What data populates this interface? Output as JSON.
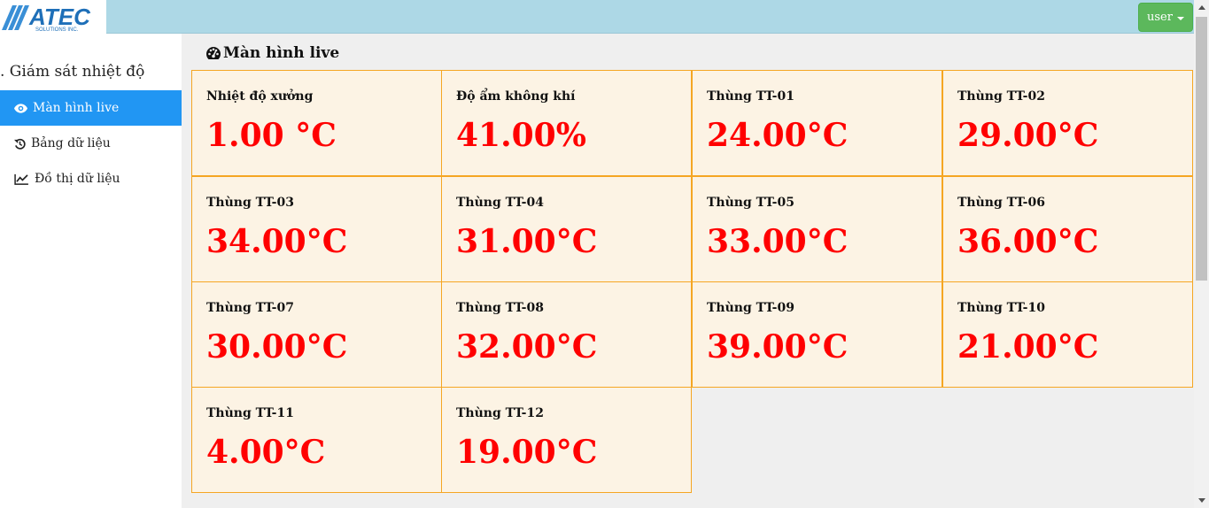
{
  "header": {
    "logo_text": "ATEC",
    "logo_subtext": "SOLUTIONS INC.",
    "user_label": "user"
  },
  "sidebar": {
    "title": ". Giám sát nhiệt độ",
    "items": [
      {
        "label": "Màn hình live",
        "icon": "eye-icon",
        "active": true
      },
      {
        "label": "Bảng dữ liệu",
        "icon": "history-icon",
        "active": false
      },
      {
        "label": "Đồ thị dữ liệu",
        "icon": "line-chart-icon",
        "active": false
      }
    ]
  },
  "main": {
    "title": "Màn hình live",
    "title_icon": "dashboard-icon",
    "cards": [
      {
        "label": "Nhiệt độ xưởng",
        "value": "1.00 °C"
      },
      {
        "label": "Độ ẩm không khí",
        "value": "41.00%"
      },
      {
        "label": "Thùng TT-01",
        "value": "24.00°C"
      },
      {
        "label": "Thùng TT-02",
        "value": "29.00°C"
      },
      {
        "label": "Thùng TT-03",
        "value": "34.00°C"
      },
      {
        "label": "Thùng TT-04",
        "value": "31.00°C"
      },
      {
        "label": "Thùng TT-05",
        "value": "33.00°C"
      },
      {
        "label": "Thùng TT-06",
        "value": "36.00°C"
      },
      {
        "label": "Thùng TT-07",
        "value": "30.00°C"
      },
      {
        "label": "Thùng TT-08",
        "value": "32.00°C"
      },
      {
        "label": "Thùng TT-09",
        "value": "39.00°C"
      },
      {
        "label": "Thùng TT-10",
        "value": "21.00°C"
      },
      {
        "label": "Thùng TT-11",
        "value": "4.00°C"
      },
      {
        "label": "Thùng TT-12",
        "value": "19.00°C"
      }
    ]
  },
  "colors": {
    "topbar": "#add8e6",
    "user_button": "#5cb85c",
    "active_item": "#2196f3",
    "card_bg": "#fcf3e4",
    "card_border": "#f5a623",
    "value_text": "#ff0000"
  }
}
